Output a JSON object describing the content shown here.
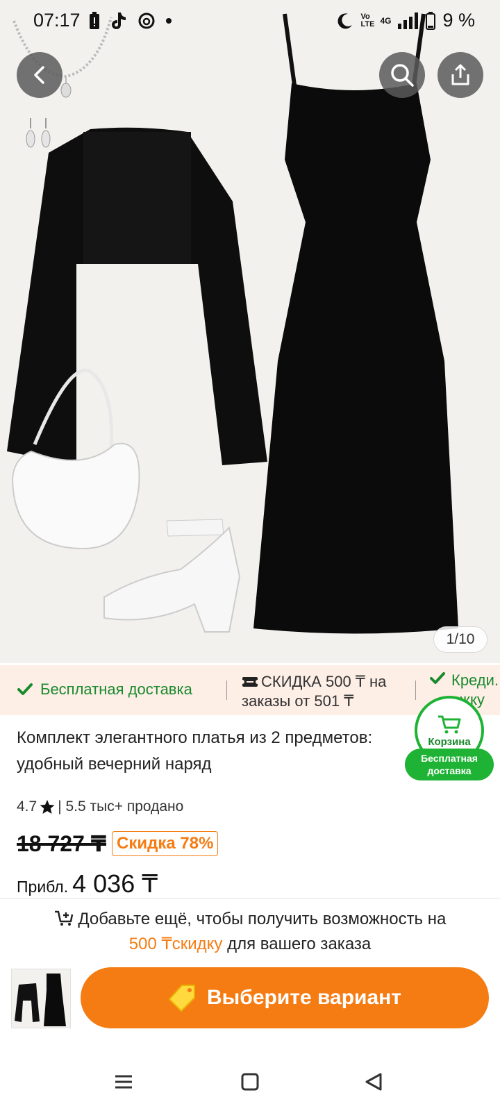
{
  "status_bar": {
    "time": "07:17",
    "battery": "9 %",
    "network": "4G",
    "volte": "Vo LTE"
  },
  "icons": {
    "back": "chevron-left-icon",
    "search": "search-icon",
    "share": "share-icon",
    "cart": "cart-icon",
    "tag": "price-tag-icon"
  },
  "gallery": {
    "counter": "1/10"
  },
  "promo": {
    "free_shipping": "Бесплатная доставка",
    "discount_text": "СКИДКА 500 ₸ на заказы от 501 ₸",
    "credit_partial": "Креди... ржку"
  },
  "cart_badge": {
    "label": "Корзина",
    "pill": "Бесплатная доставка"
  },
  "product": {
    "title": "Комплект элегантного платья из 2 предметов: удобный вечерний наряд",
    "rating": "4.7",
    "sold": "| 5.5 тыс+ продано",
    "old_price": "18 727 ₸",
    "discount": "Скидка 78%",
    "approx_label": "Прибл.",
    "price": "4 036 ₸"
  },
  "sheet": {
    "msg_line1": "Добавьте ещё, чтобы получить возможность на",
    "msg_accent": "500 ₸скидку",
    "msg_line2": " для вашего заказа",
    "cta": "Выберите вариант"
  },
  "colors": {
    "accent": "#f57c13",
    "green": "#1fb335",
    "promo_bg": "#fdeee6"
  }
}
